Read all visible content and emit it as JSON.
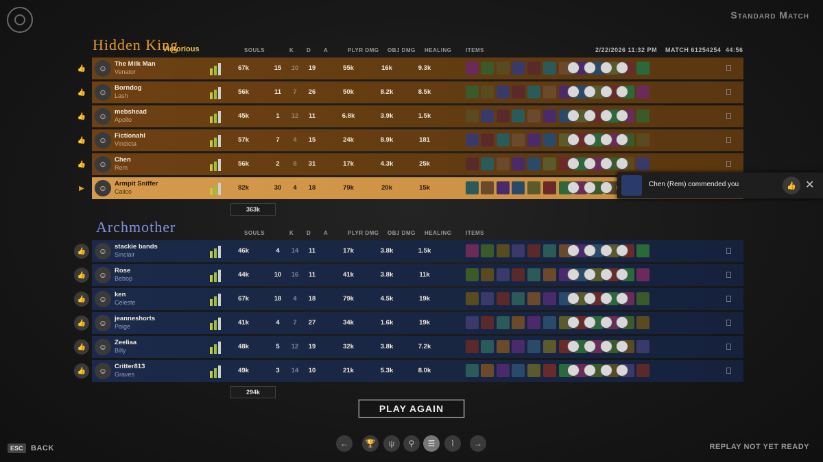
{
  "header": {
    "mode": "Standard Match",
    "date": "2/22/2026 11:32 PM",
    "match": "MATCH 61254254",
    "duration": "44:56"
  },
  "columns": {
    "souls": "SOULS",
    "k": "K",
    "d": "D",
    "a": "A",
    "plyr_dmg": "PLYR DMG",
    "obj_dmg": "OBJ DMG",
    "healing": "HEALING",
    "items": "ITEMS"
  },
  "team1": {
    "name": "Hidden King",
    "result": "Victorious",
    "total_souls": "363k",
    "players": [
      {
        "name": "The Milk Man",
        "hero": "Venator",
        "souls": "67k",
        "k": "15",
        "d": "10",
        "a": "19",
        "plyr_dmg": "55k",
        "obj_dmg": "16k",
        "healing": "9.3k"
      },
      {
        "name": "Borndog",
        "hero": "Lash",
        "souls": "56k",
        "k": "11",
        "d": "7",
        "a": "26",
        "plyr_dmg": "50k",
        "obj_dmg": "8.2k",
        "healing": "8.5k"
      },
      {
        "name": "mebshead",
        "hero": "Apollo",
        "souls": "45k",
        "k": "1",
        "d": "12",
        "a": "11",
        "plyr_dmg": "6.8k",
        "obj_dmg": "3.9k",
        "healing": "1.5k"
      },
      {
        "name": "Fictionahl",
        "hero": "Vindicta",
        "souls": "57k",
        "k": "7",
        "d": "4",
        "a": "15",
        "plyr_dmg": "24k",
        "obj_dmg": "8.9k",
        "healing": "181"
      },
      {
        "name": "Chen",
        "hero": "Rem",
        "souls": "56k",
        "k": "2",
        "d": "8",
        "a": "31",
        "plyr_dmg": "17k",
        "obj_dmg": "4.3k",
        "healing": "25k"
      },
      {
        "name": "Armpit Sniffer",
        "hero": "Calico",
        "souls": "82k",
        "k": "30",
        "d": "4",
        "a": "18",
        "plyr_dmg": "79k",
        "obj_dmg": "20k",
        "healing": "15k"
      }
    ]
  },
  "team2": {
    "name": "Archmother",
    "total_souls": "294k",
    "players": [
      {
        "name": "stackie bands",
        "hero": "Sinclair",
        "souls": "46k",
        "k": "4",
        "d": "14",
        "a": "11",
        "plyr_dmg": "17k",
        "obj_dmg": "3.8k",
        "healing": "1.5k"
      },
      {
        "name": "Rose",
        "hero": "Bebop",
        "souls": "44k",
        "k": "10",
        "d": "16",
        "a": "11",
        "plyr_dmg": "41k",
        "obj_dmg": "3.8k",
        "healing": "11k"
      },
      {
        "name": "ken",
        "hero": "Celeste",
        "souls": "67k",
        "k": "18",
        "d": "4",
        "a": "18",
        "plyr_dmg": "79k",
        "obj_dmg": "4.5k",
        "healing": "19k"
      },
      {
        "name": "jeanneshorts",
        "hero": "Paige",
        "souls": "41k",
        "k": "4",
        "d": "7",
        "a": "27",
        "plyr_dmg": "34k",
        "obj_dmg": "1.6k",
        "healing": "19k"
      },
      {
        "name": "Zeeliaa",
        "hero": "Billy",
        "souls": "48k",
        "k": "5",
        "d": "12",
        "a": "19",
        "plyr_dmg": "32k",
        "obj_dmg": "3.8k",
        "healing": "7.2k"
      },
      {
        "name": "Critter813",
        "hero": "Graves",
        "souls": "49k",
        "k": "3",
        "d": "14",
        "a": "10",
        "plyr_dmg": "21k",
        "obj_dmg": "5.3k",
        "healing": "8.0k"
      }
    ]
  },
  "toast": {
    "text": "Chen (Rem) commended you"
  },
  "play_again": "PLAY AGAIN",
  "footer": {
    "esc": "ESC",
    "back": "BACK",
    "replay": "REPLAY NOT YET READY"
  },
  "colors": {
    "team1": "#e89a2e",
    "team2": "#7e96e0",
    "highlight": "#d59a4c"
  }
}
